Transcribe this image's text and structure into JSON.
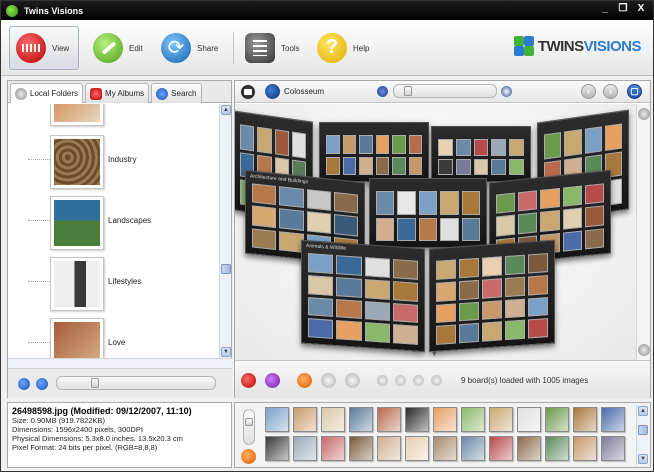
{
  "window": {
    "title": "Twins Visions",
    "controls": [
      "_",
      "❐",
      "X"
    ]
  },
  "toolbar": {
    "buttons": [
      {
        "label": "View",
        "icon": "view-icon"
      },
      {
        "label": "Edit",
        "icon": "edit-icon"
      },
      {
        "label": "Share",
        "icon": "share-icon"
      },
      {
        "label": "Tools",
        "icon": "tools-icon"
      },
      {
        "label": "Help",
        "icon": "help-icon"
      }
    ],
    "logo": {
      "part1": "TWINS",
      "part2": "VISIONS"
    }
  },
  "left_panel": {
    "tabs": [
      {
        "label": "Local Folders",
        "icon": "folder-icon",
        "active": true
      },
      {
        "label": "My Albums",
        "icon": "album-icon",
        "active": false
      },
      {
        "label": "Search",
        "icon": "search-icon",
        "active": false
      }
    ],
    "folders": [
      {
        "label": "",
        "colors": [
          "#c97a3a",
          "#e8d7c0"
        ]
      },
      {
        "label": "Industry",
        "colors": [
          "#6f4b2a",
          "#9a7a50"
        ]
      },
      {
        "label": "Landscapes",
        "colors": [
          "#2f6f9e",
          "#4a7d3a"
        ]
      },
      {
        "label": "Lifestyles",
        "colors": [
          "#efefef",
          "#3a3a3a"
        ]
      },
      {
        "label": "Love",
        "colors": [
          "#a85a3a",
          "#d8b48a"
        ]
      }
    ]
  },
  "viewer": {
    "collection_label": "Colosseum",
    "status": "9 board(s) loaded with 1005 images",
    "boards": [
      {
        "caption": "",
        "cols": 4
      },
      {
        "caption": "",
        "cols": 6
      },
      {
        "caption": "",
        "cols": 5
      },
      {
        "caption": "",
        "cols": 4
      },
      {
        "caption": "Architecture and Buildings",
        "cols": 4
      },
      {
        "caption": "",
        "cols": 5
      },
      {
        "caption": "",
        "cols": 5
      },
      {
        "caption": "Animals & Wildlife",
        "cols": 4
      },
      {
        "caption": "",
        "cols": 5
      }
    ]
  },
  "info": {
    "filename": "26498598.jpg  (Modified: 09/12/2007, 11:10)",
    "size": "Size: 0.90MB (919.7822KB)",
    "dimensions": "Dimensions: 1596x2400 pixels, 300DPI",
    "physical": "Physical Dimensions: 5.3x8.0 inches, 13.5x20.3 cm",
    "pixel_format": "Pixel Format: 24 bits per pixel. (RGB=8,8,8)"
  },
  "filmstrip": {
    "thumb_colors": [
      "#7aa0c8",
      "#c89a6a",
      "#d8c8a8",
      "#5a7a9a",
      "#b86a4a",
      "#2a2a2a",
      "#e8a060",
      "#8ab86a",
      "#c8a870",
      "#e0e0e0",
      "#6a9a4a",
      "#a8783a",
      "#4a6aa8",
      "#3a3a3a",
      "#9aaab8",
      "#c86a6a",
      "#7a5a3a",
      "#d0b090",
      "#e8d0b0",
      "#a88868",
      "#6a8aa8",
      "#b84a4a",
      "#8a6a4a",
      "#5a8a5a",
      "#c8986a",
      "#7a7a9a"
    ]
  }
}
